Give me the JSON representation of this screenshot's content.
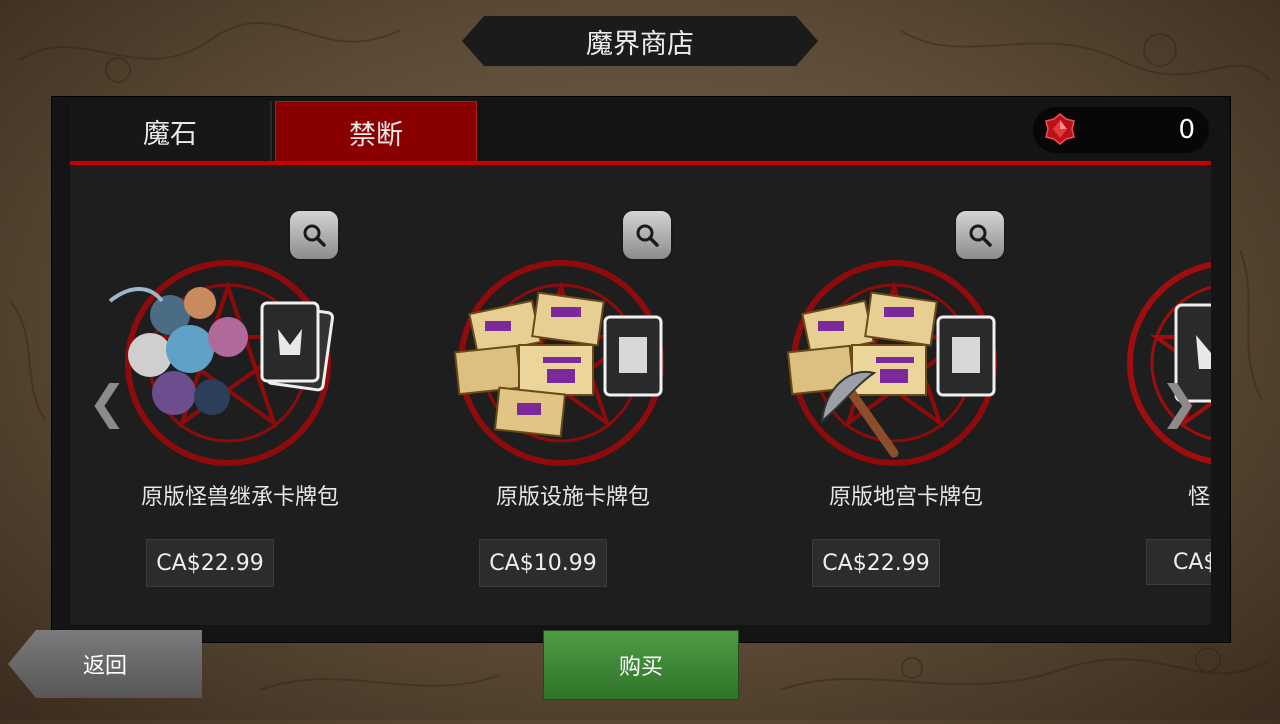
{
  "title": "魔界商店",
  "tabs": [
    {
      "label": "魔石",
      "active": false
    },
    {
      "label": "禁断",
      "active": true
    }
  ],
  "currency": {
    "icon": "red-gem-icon",
    "value": "0"
  },
  "items": [
    {
      "name": "原版怪兽继承卡牌包",
      "price": "CA$22.99",
      "art": "monster-party-with-cards"
    },
    {
      "name": "原版设施卡牌包",
      "price": "CA$10.99",
      "art": "scrolls-with-card"
    },
    {
      "name": "原版地宫卡牌包",
      "price": "CA$22.99",
      "art": "scrolls-pickaxe-with-card"
    },
    {
      "name": "怪兽",
      "price": "CA$",
      "art": "skull-card"
    }
  ],
  "nav": {
    "prev_icon": "chevron-left-icon",
    "next_icon": "chevron-right-icon"
  },
  "buttons": {
    "back": "返回",
    "buy": "购买"
  },
  "colors": {
    "accent_red": "#c40000",
    "tab_active": "#8a0000",
    "buy_green": "#3f8a38"
  }
}
